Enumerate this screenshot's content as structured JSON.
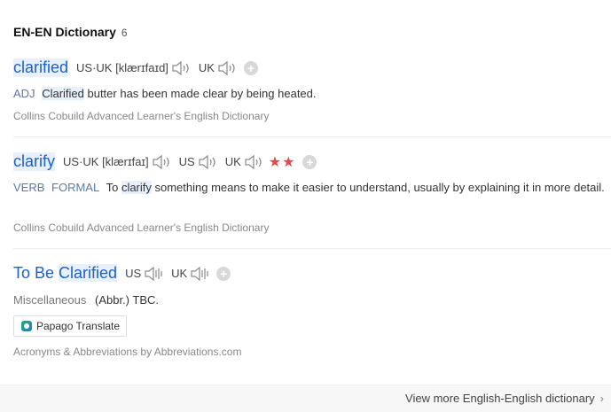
{
  "section": {
    "title": "EN-EN Dictionary",
    "count": "6"
  },
  "entries": [
    {
      "headword": "clarified",
      "pron_label": "US·UK [klærɪfaɪd]",
      "uk_label": "UK",
      "pos": "ADJ",
      "def_word": "Clarified",
      "def_rest": " butter has been made clear by being heated.",
      "source": "Collins Cobuild Advanced Learner's English Dictionary"
    },
    {
      "headword": "clarify",
      "pron_label": "US·UK [klærɪfaɪ]",
      "us_label": "US",
      "uk_label": "UK",
      "stars": "★★",
      "pos": "VERB",
      "register": "FORMAL",
      "def_pre": "To ",
      "def_word": "clarify",
      "def_rest": " something means to make it easier to understand, usually by explaining it in more detail.",
      "source": "Collins Cobuild Advanced Learner's English Dictionary"
    },
    {
      "headword_pre": "To Be ",
      "headword_word": "Clarified",
      "us_label": "US",
      "uk_label": "UK",
      "category": "Miscellaneous",
      "meaning": "(Abbr.) TBC.",
      "translate_button": "Papago Translate",
      "source": "Acronyms & Abbreviations by Abbreviations.com"
    }
  ],
  "footer": {
    "view_more": "View more English-English dictionary",
    "chevron": "›"
  },
  "icons": {
    "speaker": "speaker-icon",
    "add": "add-icon",
    "papago": "papago-icon"
  },
  "colors": {
    "headword": "#2160c4",
    "stars": "#e04b4b",
    "highlight": "#e8f0fb"
  }
}
